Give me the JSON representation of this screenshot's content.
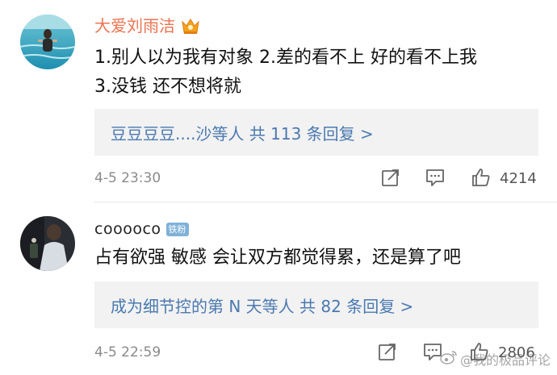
{
  "comments": [
    {
      "username": "大爱刘雨洁",
      "vip": true,
      "text_lines": [
        "1.别人以为我有对象  2.差的看不上 好的看不上我",
        "3.没钱 还不想将就"
      ],
      "replies_summary": "豆豆豆豆....沙等人 共 113 条回复 >",
      "time": "4-5 23:30",
      "likes": "4214"
    },
    {
      "username": "cooooco",
      "badge": "铁粉",
      "text_lines": [
        "占有欲强 敏感 会让双方都觉得累，还是算了吧"
      ],
      "replies_summary": "成为细节控的第 N 天等人 共 82 条回复 >",
      "time": "4-5 22:59",
      "likes": "2806"
    }
  ],
  "watermark": "@我的极品评论",
  "icons": {
    "share": "share-icon",
    "comment": "comment-icon",
    "like": "like-icon",
    "crown": "crown-icon",
    "weibo": "weibo-logo-icon"
  },
  "colors": {
    "vip_name": "#eb7350",
    "link": "#4a79b0",
    "reply_bg": "#f2f2f2",
    "meta": "#8a8a8a"
  }
}
